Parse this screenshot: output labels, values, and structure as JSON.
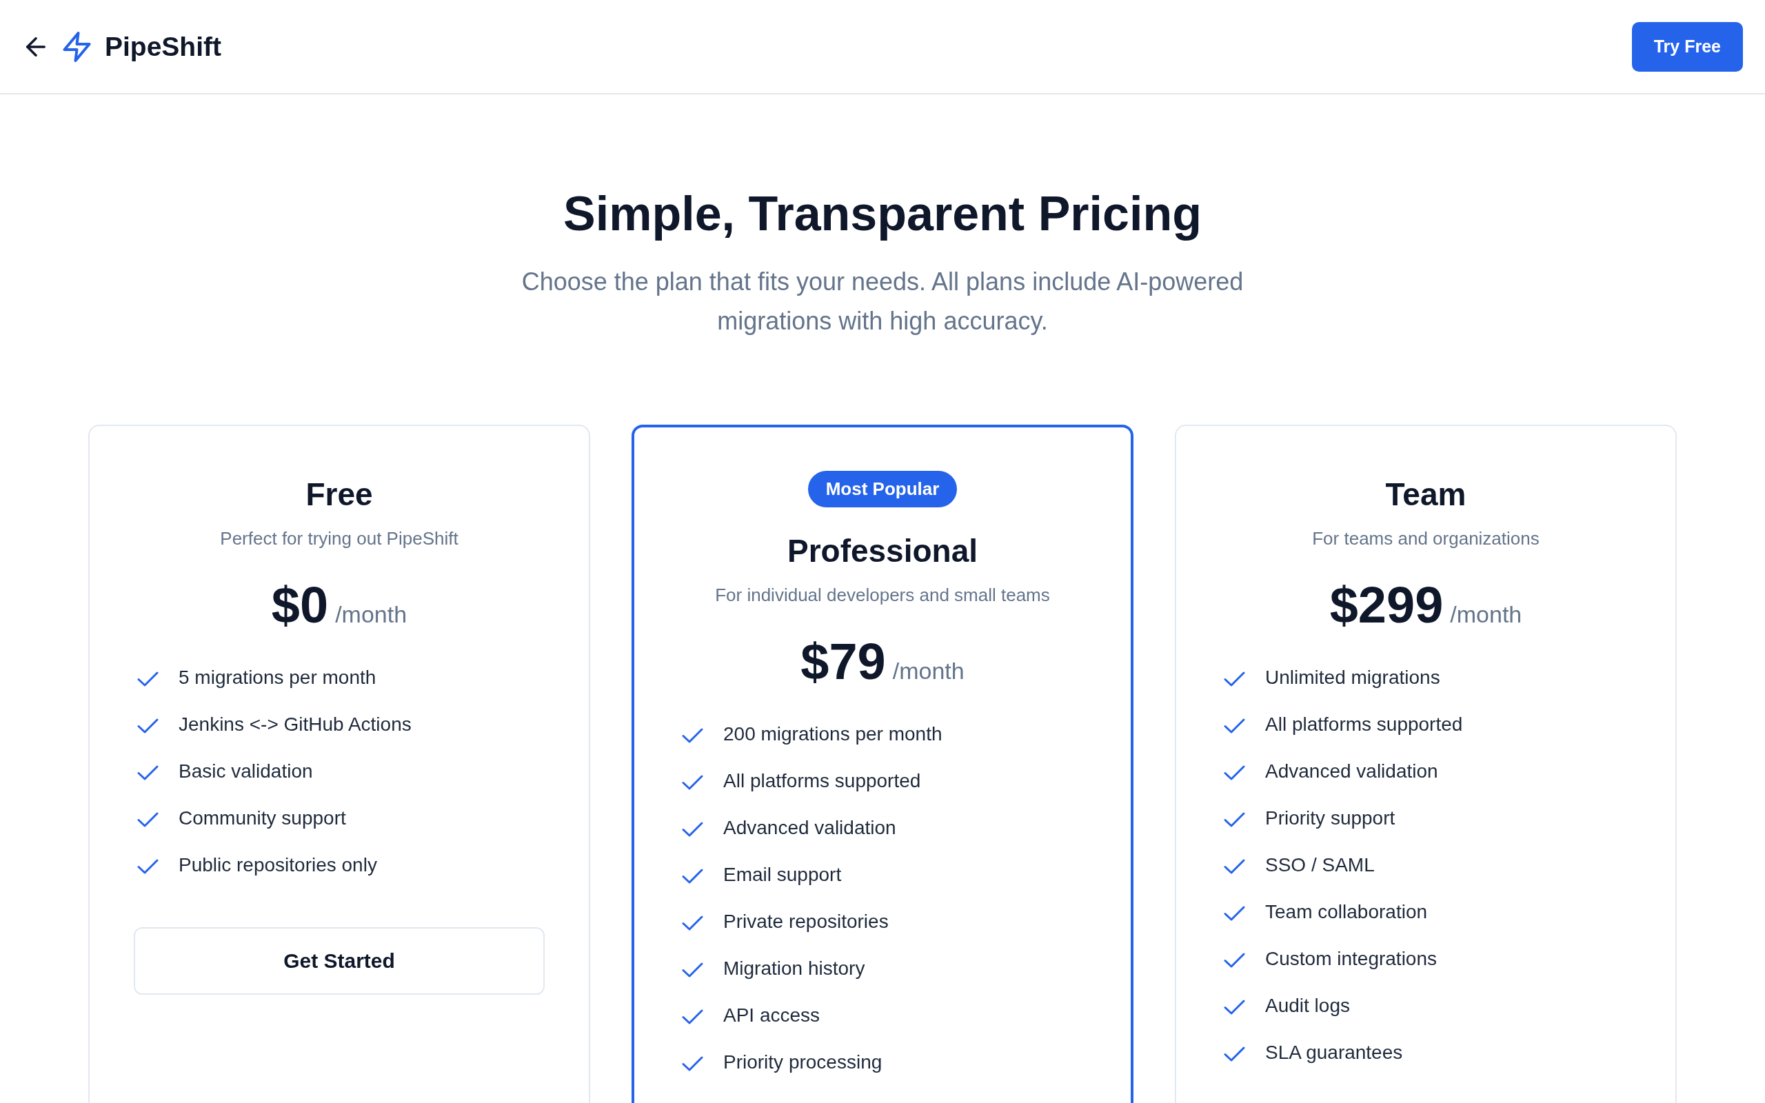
{
  "header": {
    "brand": "PipeShift",
    "cta": "Try Free"
  },
  "hero": {
    "title": "Simple, Transparent Pricing",
    "subtitle": "Choose the plan that fits your needs. All plans include AI-powered migrations with high accuracy."
  },
  "plans": [
    {
      "name": "Free",
      "description": "Perfect for trying out PipeShift",
      "price": "$0",
      "period": "/month",
      "featured": false,
      "features": [
        "5 migrations per month",
        "Jenkins <-> GitHub Actions",
        "Basic validation",
        "Community support",
        "Public repositories only"
      ],
      "button": "Get Started"
    },
    {
      "name": "Professional",
      "badge": "Most Popular",
      "description": "For individual developers and small teams",
      "price": "$79",
      "period": "/month",
      "featured": true,
      "features": [
        "200 migrations per month",
        "All platforms supported",
        "Advanced validation",
        "Email support",
        "Private repositories",
        "Migration history",
        "API access",
        "Priority processing"
      ]
    },
    {
      "name": "Team",
      "description": "For teams and organizations",
      "price": "$299",
      "period": "/month",
      "featured": false,
      "features": [
        "Unlimited migrations",
        "All platforms supported",
        "Advanced validation",
        "Priority support",
        "SSO / SAML",
        "Team collaboration",
        "Custom integrations",
        "Audit logs",
        "SLA guarantees"
      ]
    }
  ]
}
